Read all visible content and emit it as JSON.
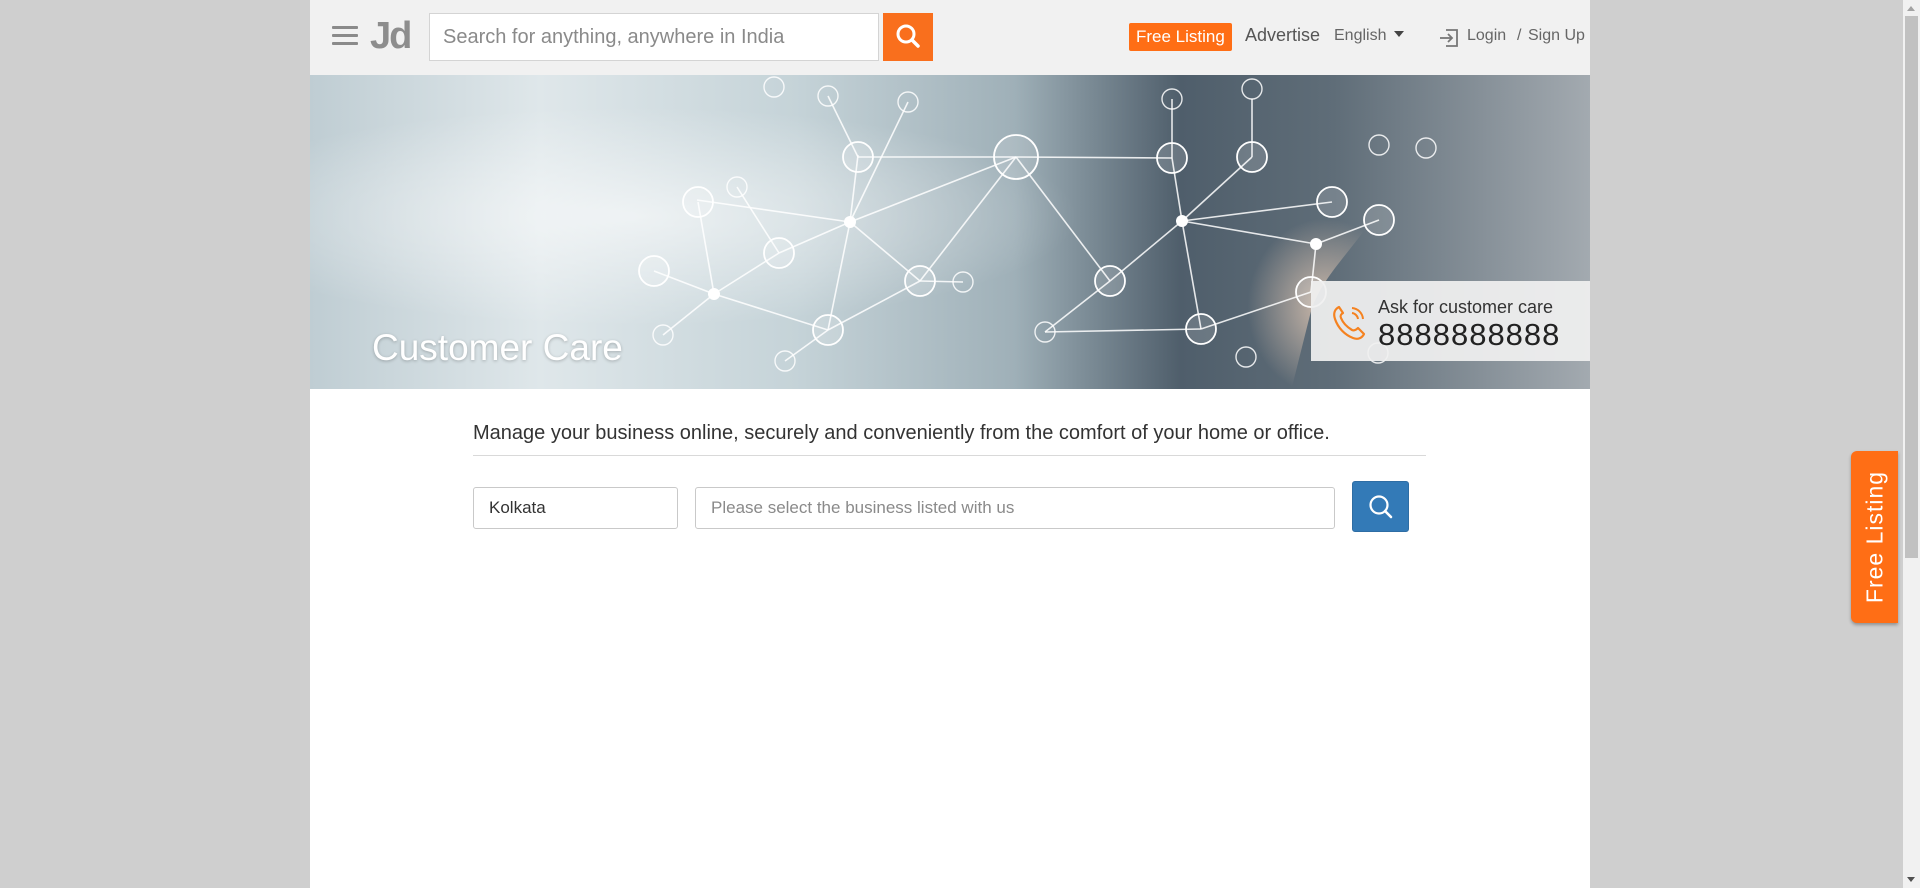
{
  "header": {
    "logo": "Jd",
    "search_placeholder": "Search for anything, anywhere in India",
    "free_listing": "Free Listing",
    "advertise": "Advertise",
    "language": "English",
    "login": "Login",
    "separator": "/",
    "signup": "Sign Up"
  },
  "banner": {
    "title": "Customer Care",
    "care_label": "Ask for customer care",
    "care_number": "8888888888"
  },
  "main": {
    "tagline": "Manage your business online, securely and conveniently from the comfort of your home or office.",
    "city_value": "Kolkata",
    "business_placeholder": "Please select the business listed with us"
  },
  "side_tab": {
    "label": "Free Listing"
  },
  "colors": {
    "accent": "#ff6e15",
    "button_blue": "#337ab7"
  },
  "icons": [
    "menu-icon",
    "search-icon",
    "caret-down-icon",
    "login-icon",
    "phone-icon"
  ]
}
